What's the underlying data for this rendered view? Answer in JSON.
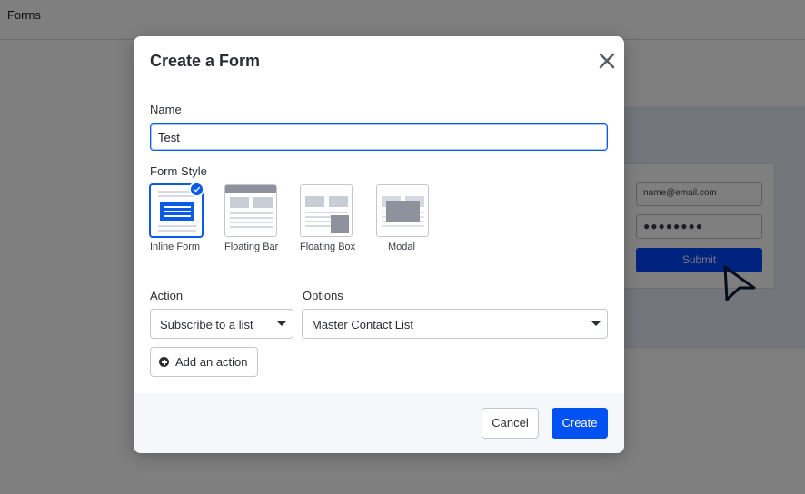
{
  "page": {
    "title": "Forms"
  },
  "preview": {
    "email_placeholder": "name@email.com",
    "password_mask": "●●●●●●●●",
    "submit_label": "Submit"
  },
  "modal": {
    "title": "Create a Form",
    "name_label": "Name",
    "name_value": "Test",
    "form_style_label": "Form Style",
    "styles": [
      {
        "label": "Inline Form",
        "selected": true
      },
      {
        "label": "Floating Bar",
        "selected": false
      },
      {
        "label": "Floating Box",
        "selected": false
      },
      {
        "label": "Modal",
        "selected": false
      }
    ],
    "action_label": "Action",
    "action_value": "Subscribe to a list",
    "options_label": "Options",
    "options_value": "Master Contact List",
    "add_action_label": "Add an action",
    "cancel_label": "Cancel",
    "create_label": "Create"
  },
  "colors": {
    "accent": "#0051f2",
    "overlay": "rgba(0,0,0,0.5)",
    "footer_bg": "#f5f7fb"
  }
}
